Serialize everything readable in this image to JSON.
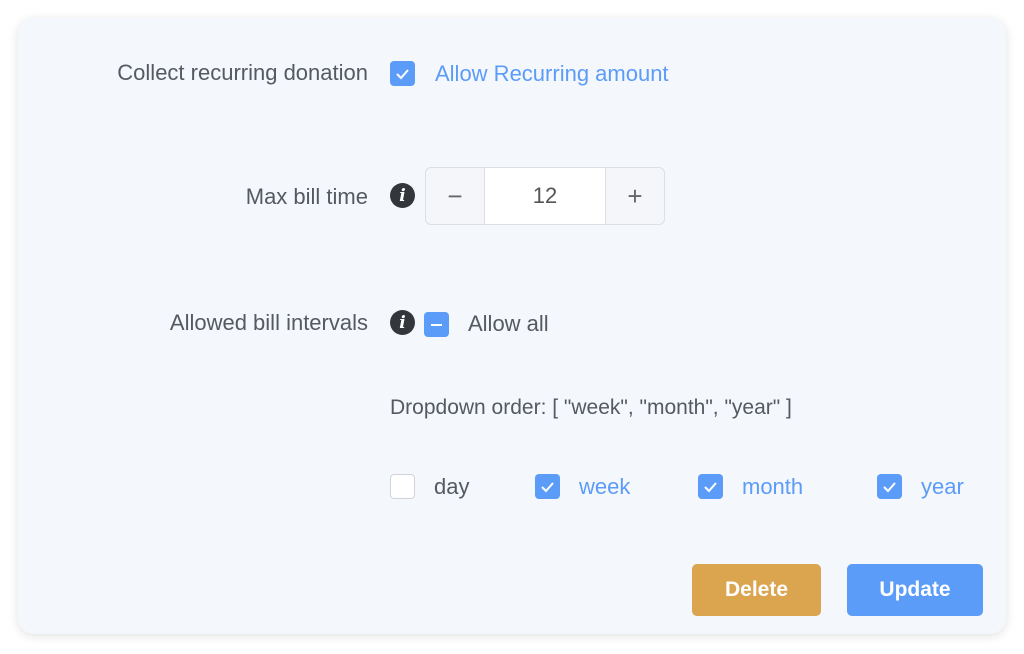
{
  "recurring": {
    "label": "Collect recurring donation",
    "checkbox_label": "Allow Recurring amount",
    "checked": true
  },
  "max_bill_time": {
    "label": "Max bill time",
    "info_icon": "info-icon",
    "value": "12",
    "decrement": "−",
    "increment": "+"
  },
  "intervals": {
    "label": "Allowed bill intervals",
    "info_icon": "info-icon",
    "allow_all_label": "Allow all",
    "allow_all_state": "indeterminate",
    "dropdown_order": "Dropdown order: [ \"week\", \"month\", \"year\" ]",
    "options": [
      {
        "label": "day",
        "checked": false
      },
      {
        "label": "week",
        "checked": true
      },
      {
        "label": "month",
        "checked": true
      },
      {
        "label": "year",
        "checked": true
      }
    ]
  },
  "actions": {
    "delete_label": "Delete",
    "update_label": "Update"
  },
  "colors": {
    "accent": "#5b9cf8",
    "delete": "#dba44e",
    "card_bg": "#f4f7fc"
  }
}
